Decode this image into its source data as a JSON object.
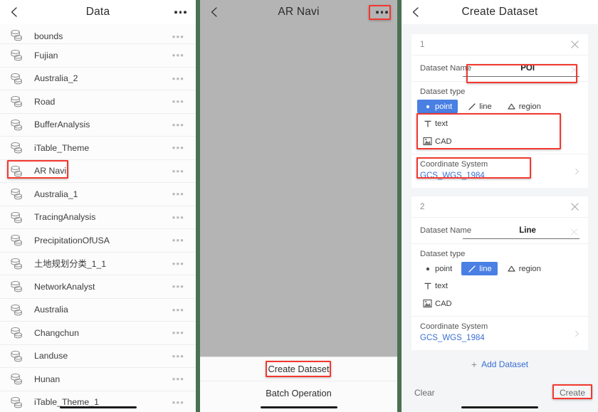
{
  "panel1": {
    "nav": {
      "title": "Data",
      "back_icon": "chevron-left-icon",
      "menu_icon": "more-dots-icon"
    },
    "rows": [
      {
        "name": "bounds"
      },
      {
        "name": "Fujian"
      },
      {
        "name": "Australia_2"
      },
      {
        "name": "Road"
      },
      {
        "name": "BufferAnalysis"
      },
      {
        "name": "iTable_Theme"
      },
      {
        "name": "AR Navi"
      },
      {
        "name": "Australia_1"
      },
      {
        "name": "TracingAnalysis"
      },
      {
        "name": "PrecipitationOfUSA"
      },
      {
        "name": "土地规划分类_1_1"
      },
      {
        "name": "NetworkAnalyst"
      },
      {
        "name": "Australia"
      },
      {
        "name": "Changchun"
      },
      {
        "name": "Landuse"
      },
      {
        "name": "Hunan"
      },
      {
        "name": "iTable_Theme_1"
      }
    ],
    "row_menu_icon": "more-dots-icon",
    "row_icon": "database-icon"
  },
  "panel2": {
    "nav": {
      "title": "AR Navi",
      "back_icon": "chevron-left-icon",
      "menu_icon": "more-dots-icon"
    },
    "sheet": {
      "create_dataset": "Create Dataset",
      "batch_operation": "Batch Operation"
    }
  },
  "panel3": {
    "nav": {
      "title": "Create Dataset",
      "back_icon": "chevron-left-icon"
    },
    "sections": [
      {
        "index": "1",
        "close_icon": "close-icon",
        "name_label": "Dataset Name",
        "name_value": "POI",
        "name_placeholder": "Dataset Name",
        "clear_icon": "close-icon",
        "type_label": "Dataset type",
        "types": [
          {
            "label": "point",
            "icon": "dot-icon",
            "selected": true
          },
          {
            "label": "line",
            "icon": "line-icon",
            "selected": false
          },
          {
            "label": "region",
            "icon": "polygon-icon",
            "selected": false
          },
          {
            "label": "text",
            "icon": "text-t-icon",
            "selected": false
          },
          {
            "label": "CAD",
            "icon": "cad-icon",
            "selected": false
          }
        ],
        "cs_label": "Coordinate System",
        "cs_value": "GCS_WGS_1984",
        "chevron_icon": "chevron-right-icon"
      },
      {
        "index": "2",
        "close_icon": "close-icon",
        "name_label": "Dataset Name",
        "name_value": "Line",
        "name_placeholder": "Dataset Name",
        "clear_icon": "close-icon",
        "type_label": "Dataset type",
        "types": [
          {
            "label": "point",
            "icon": "dot-icon",
            "selected": false
          },
          {
            "label": "line",
            "icon": "line-icon",
            "selected": true
          },
          {
            "label": "region",
            "icon": "polygon-icon",
            "selected": false
          },
          {
            "label": "text",
            "icon": "text-t-icon",
            "selected": false
          },
          {
            "label": "CAD",
            "icon": "cad-icon",
            "selected": false
          }
        ],
        "cs_label": "Coordinate System",
        "cs_value": "GCS_WGS_1984",
        "chevron_icon": "chevron-right-icon"
      }
    ],
    "add_dataset": "+ Add Dataset",
    "add_dataset_label": "Add Dataset",
    "add_icon": "plus-icon",
    "footer": {
      "clear": "Clear",
      "create": "Create"
    }
  },
  "colors": {
    "accent_blue": "#4a7fe4",
    "link_blue": "#3a6fd0",
    "highlight_red": "#f3382f",
    "panel_divider_green": "#4a7154",
    "panel2_body": "#b4b4b4"
  }
}
